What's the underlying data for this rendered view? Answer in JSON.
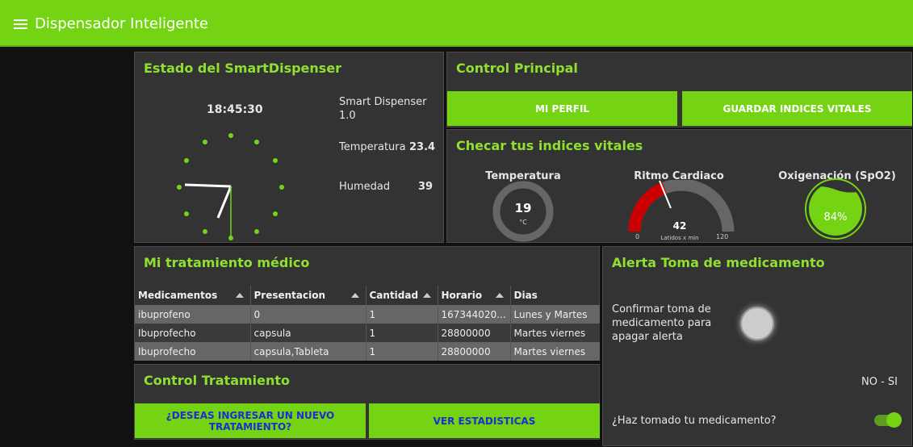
{
  "app": {
    "title": "Dispensador Inteligente"
  },
  "estado": {
    "title": "Estado del SmartDispenser",
    "clock_time": "18:45:30",
    "device_name_line1": "Smart Dispenser",
    "device_name_line2": "1.0",
    "temp_label": "Temperatura",
    "temp_value": "23.4",
    "hum_label": "Humedad",
    "hum_value": "39"
  },
  "control_principal": {
    "title": "Control Principal",
    "btn_perfil": "MI PERFIL",
    "btn_guardar": "GUARDAR INDICES VITALES"
  },
  "vitales": {
    "title": "Checar tus indices vitales",
    "temp_title": "Temperatura",
    "temp_value": "19",
    "temp_unit": "°C",
    "ritmo_title": "Ritmo Cardiaco",
    "ritmo_value": "42",
    "ritmo_unit": "Latidos x min",
    "ritmo_min": "0",
    "ritmo_max": "120",
    "oxi_title": "Oxigenación (SpO2)",
    "oxi_value": "84%",
    "oxi_fraction": 0.84,
    "accent_color": "#74d414",
    "alarm_color": "#cc0000"
  },
  "tratamiento": {
    "title": "Mi tratamiento médico",
    "columns": [
      "Medicamentos",
      "Presentacion",
      "Cantidad",
      "Horario",
      "Dias"
    ],
    "rows": [
      [
        "ibuprofeno",
        "0",
        "1",
        "167344020...",
        "Lunes y Martes"
      ],
      [
        "Ibuprofecho",
        "capsula",
        "1",
        "28800000",
        "Martes viernes"
      ],
      [
        "Ibuprofecho",
        "capsula,Tableta",
        "1",
        "28800000",
        "Martes viernes"
      ]
    ]
  },
  "control_tratamiento": {
    "title": "Control Tratamiento",
    "btn_nuevo": "¿DESEAS INGRESAR UN NUEVO TRATAMIENTO?",
    "btn_estadisticas": "VER ESTADISTICAS"
  },
  "alerta": {
    "title": "Alerta Toma de medicamento",
    "confirm_line1": "Confirmar toma de",
    "confirm_line2": "medicamento para",
    "confirm_line3": "apagar alerta",
    "no_si": "NO - SI",
    "pregunta": "¿Haz tomado tu medicamento?"
  }
}
